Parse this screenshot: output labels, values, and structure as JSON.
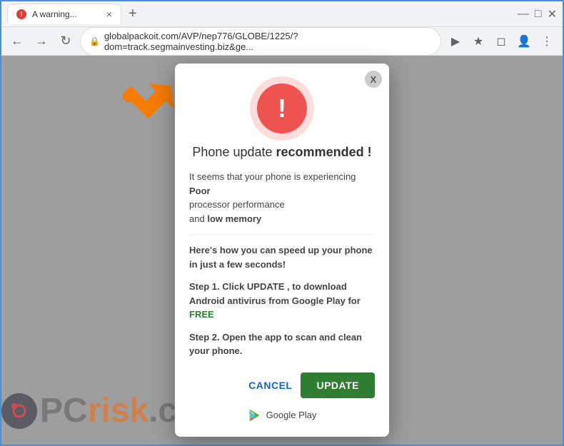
{
  "browser": {
    "tab_title": "A warning...",
    "url": "globalpackoit.com/AVP/nep776/GLOBE/1225/?dom=track.segmainvesting.biz&ge...",
    "new_tab_label": "+",
    "close_tab_label": "×"
  },
  "window_controls": {
    "minimize": "—",
    "maximize": "□",
    "close": "✕"
  },
  "popup": {
    "close_label": "X",
    "title_normal": "Phone update",
    "title_highlight": "recommended !",
    "body_line1": "It seems that your phone is experiencing",
    "body_bold1": "Poor",
    "body_line2": "processor performance",
    "body_line3": "and",
    "body_bold2": "low memory",
    "speed_title": "Here's how you can speed up your phone in just a few seconds!",
    "step1": "Step 1. Click UPDATE , to download Android antivirus from Google Play for",
    "step1_free": "FREE",
    "step2": "Step 2. Open the app to scan and clean your phone.",
    "cancel_label": "CANCEL",
    "update_label": "UPDATE",
    "google_play_label": "Google Play"
  },
  "watermark": {
    "pc_text": "PC",
    "risk_text": "risk",
    "suffix": ".com"
  }
}
